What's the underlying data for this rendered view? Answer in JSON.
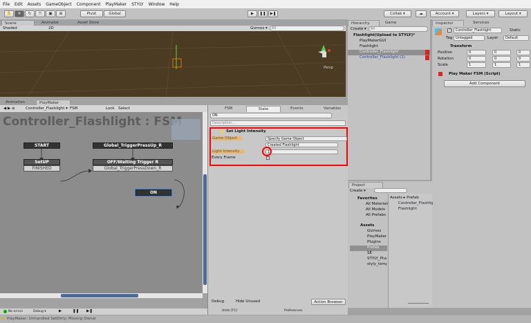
{
  "menu": [
    "File",
    "Edit",
    "Assets",
    "GameObject",
    "Component",
    "PlayMaker",
    "STYLY",
    "Window",
    "Help"
  ],
  "toolbar": {
    "pivot": "Pivot",
    "global": "Global",
    "collab": "Collab ▾",
    "account": "Account ▾",
    "layers": "Layers ▾",
    "layout": "Layout ▾"
  },
  "scene": {
    "tabs": [
      "Scene",
      "Animator",
      "Asset Store"
    ],
    "shading": "Shaded",
    "mode_2d": "2D",
    "gizmos": "Gizmos ▾",
    "search_placeholder": "All",
    "persp": "Persp",
    "background_color": "#4a3b22"
  },
  "hierarchy": {
    "tabs": [
      "Hierarchy",
      "Game"
    ],
    "create": "Create ▾",
    "search_placeholder": "All",
    "scene_name": "Flashlight(Upload to STYLY)*",
    "items": [
      "PlayMakerGUI",
      "Flashlight",
      "Controller_Flashlight",
      "Controller_Flashlight (1)"
    ]
  },
  "inspector": {
    "tabs": [
      "Inspector",
      "Services"
    ],
    "object_name": "Controller_Flashlight",
    "static": "Static",
    "tag_label": "Tag",
    "tag": "Untagged",
    "layer_label": "Layer",
    "layer": "Default",
    "transform": "Transform",
    "rows": [
      {
        "label": "Position",
        "x": "0",
        "y": "0",
        "z": "0"
      },
      {
        "label": "Rotation",
        "x": "0",
        "y": "0",
        "z": "0"
      },
      {
        "label": "Scale",
        "x": "1",
        "y": "1",
        "z": "1"
      }
    ],
    "fsm": "Play Maker FSM (Script)",
    "add_component": "Add Component"
  },
  "playmaker": {
    "tabs": [
      "Animation",
      "PlayMaker"
    ],
    "object": "Controller_Flashlight ▾",
    "fsm": "FSM",
    "lock": "Lock",
    "select": "Select",
    "title": "Controller_Flashlight : FSM",
    "nodes": {
      "start": "START",
      "global": "Global_TriggerPressUp_R",
      "setup": "SetUP",
      "finished": "FINISHED",
      "off": "OFF/Waiting Trigger R",
      "off_event": "Global_TriggerPressDown_R",
      "on": "ON"
    },
    "panel_tabs": [
      "FSM",
      "State",
      "Events",
      "Variables"
    ],
    "state_name": "ON",
    "description_placeholder": "Description...",
    "action": {
      "title": "Set Light Intensity",
      "game_object_label": "Game Object",
      "game_object": "Specify Game Object",
      "target": "Created Flashlight",
      "light_intensity_label": "Light Intensity",
      "light_intensity": "1",
      "every_frame_label": "Every Frame"
    },
    "debug": "Debug",
    "hide_unused": "Hide Unused",
    "action_browser": "Action Browser",
    "hints": "Hints [F1]",
    "preferences": "Preferences",
    "no_errors": "No errors",
    "debug_menu": "Debug ▾"
  },
  "project": {
    "tab": "Project",
    "create": "Create ▾",
    "favorites": "Favorites",
    "fav_items": [
      "All Materials",
      "All Models",
      "All Prefabs"
    ],
    "assets": "Assets",
    "folders": [
      "Gizmos",
      "PlayMaker",
      "Plugins",
      "Prefab",
      "SE",
      "STYLY_Plugin",
      "styly_temp"
    ],
    "breadcrumb": "Assets ▸ Prefab",
    "files": [
      "Controller_Flashlight",
      "Flashlight"
    ]
  },
  "status": {
    "message": "PlayMaker: Unhandled SetDirty: Missing Owner"
  },
  "colors": {
    "highlight": "#ff0000",
    "selected_node": "#3a7bd5"
  }
}
